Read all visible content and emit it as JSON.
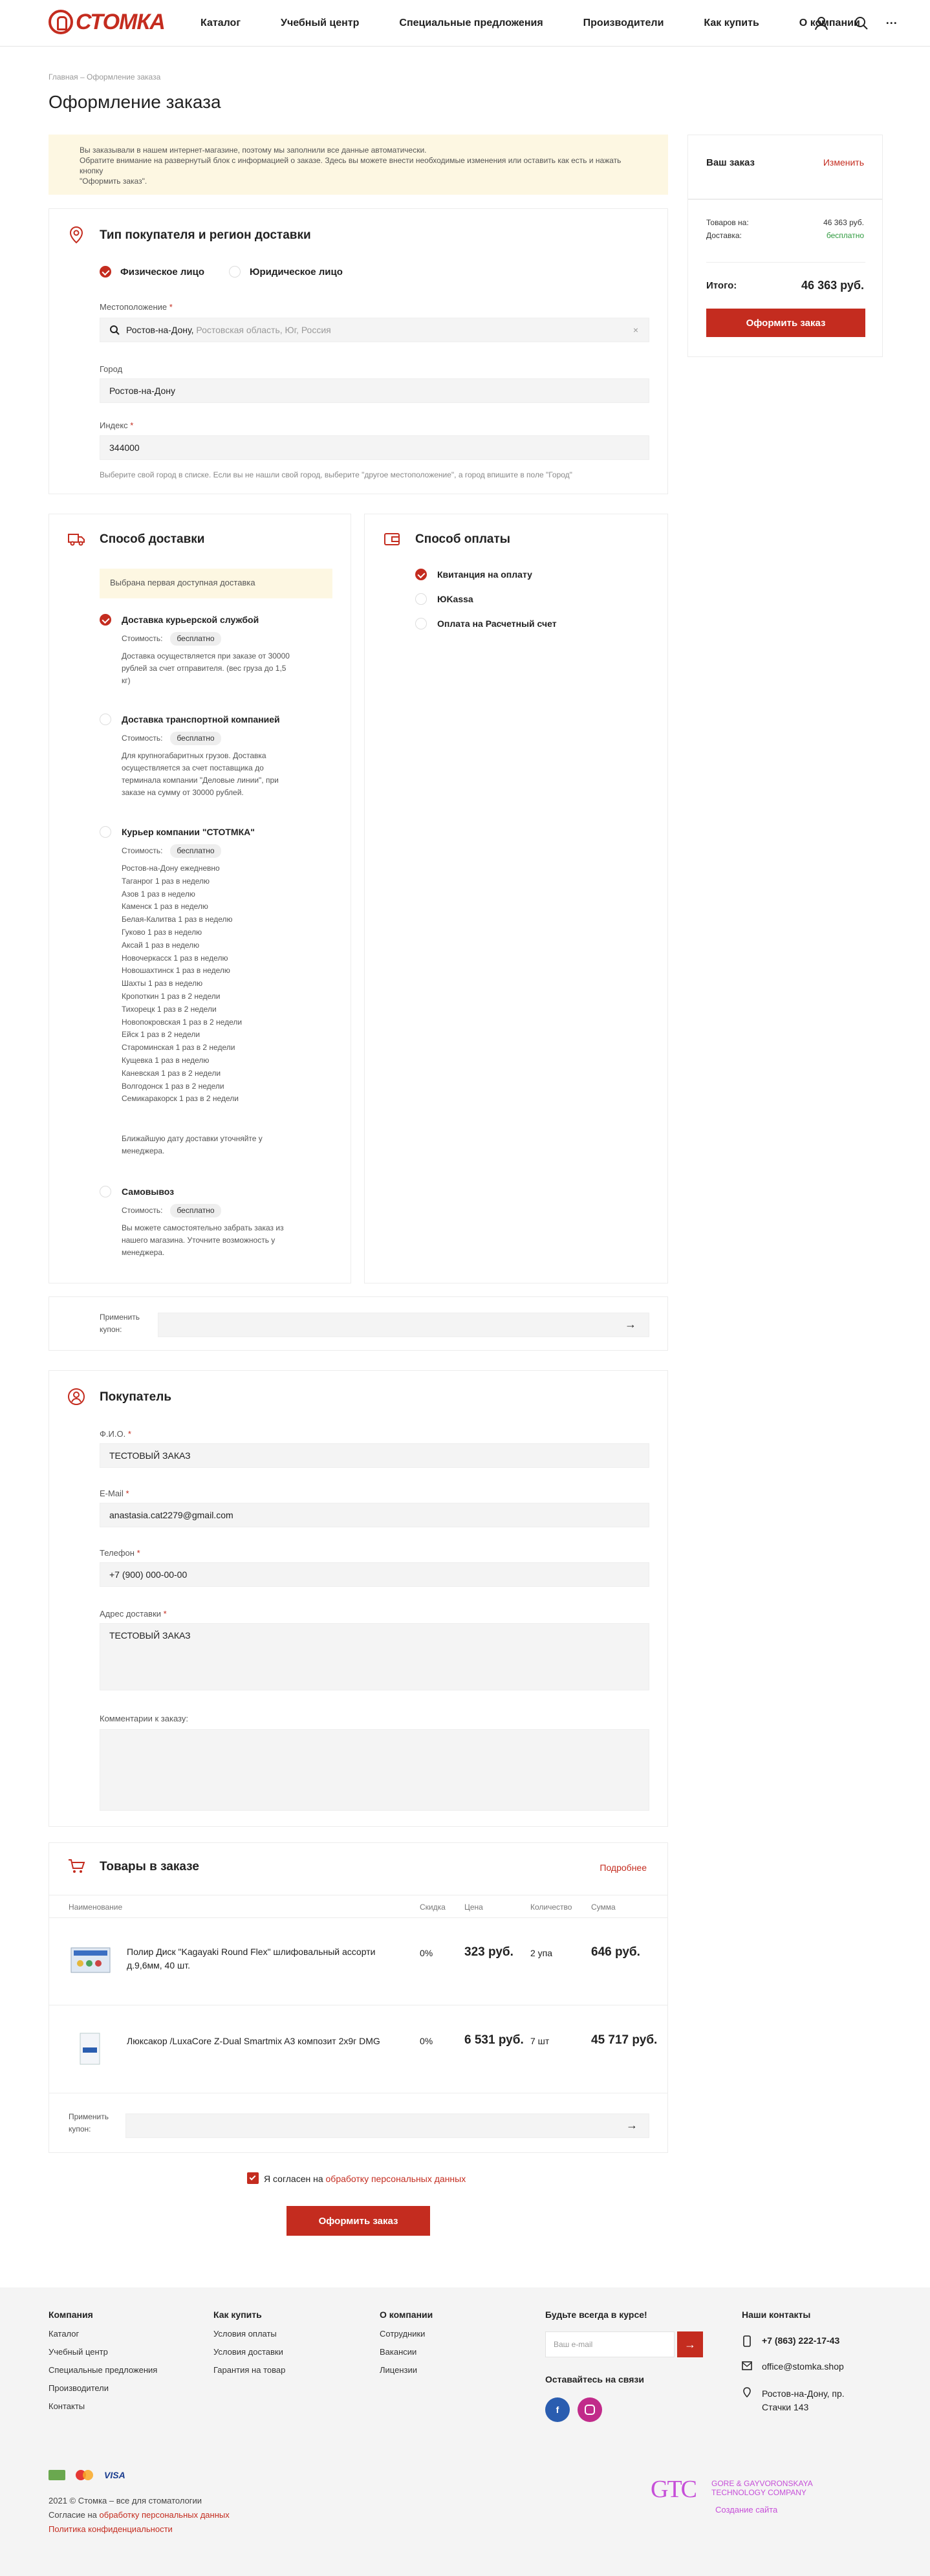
{
  "header": {
    "logo": "СТОМКА",
    "nav": [
      "Каталог",
      "Учебный центр",
      "Специальные предложения",
      "Производители",
      "Как купить",
      "О компании"
    ],
    "more": "···"
  },
  "breadcrumb": "Главная  –  Оформление заказа",
  "page_title": "Оформление заказа",
  "notice": {
    "line1": "Вы заказывали в нашем интернет-магазине, поэтому мы заполнили все данные автоматически.",
    "line2": "Обратите внимание на развернутый блок с информацией о заказе. Здесь вы можете внести необходимые изменения или оставить как есть и нажать кнопку",
    "line3": "\"Оформить заказ\"."
  },
  "buyer_type": {
    "title": "Тип покупателя и регион доставки",
    "option1": "Физическое лицо",
    "option2": "Юридическое лицо",
    "location_label": "Местоположение",
    "location_value": "Ростов-на-Дону,",
    "location_hint": "Ростовская область, Юг, Россия",
    "city_label": "Город",
    "city_value": "Ростов-на-Дону",
    "index_label": "Индекс",
    "index_value": "344000",
    "help": "Выберите свой город в списке. Если вы не нашли свой город, выберите \"другое местоположение\", а город впишите в поле \"Город\""
  },
  "summary": {
    "title": "Ваш заказ",
    "edit": "Изменить",
    "goods_label": "Товаров на:",
    "goods_value": "46 363 руб.",
    "delivery_label": "Доставка:",
    "delivery_value": "бесплатно",
    "total_label": "Итого:",
    "total_value": "46 363 руб.",
    "button": "Оформить заказ"
  },
  "delivery": {
    "title": "Способ доставки",
    "first_note": "Выбрана первая доступная доставка",
    "cost_label": "Стоимость:",
    "free": "бесплатно",
    "opt1_title": "Доставка курьерской службой",
    "opt1_desc": "Доставка осуществляется при заказе от 30000 рублей за счет отправителя. (вес груза до 1,5 кг)",
    "opt2_title": "Доставка транспортной компанией",
    "opt2_desc": "Для крупногабаритных грузов. Доставка осуществляется за счет поставщика до терминала компании \"Деловые линии\", при заказе на сумму от 30000 рублей.",
    "opt3_title": "Курьер компании \"СТОТМКА\"",
    "opt3_schedule": [
      "Ростов-на-Дону ежедневно",
      "Таганрог 1 раз в неделю",
      "Азов 1 раз в неделю",
      "Каменск 1 раз в неделю",
      "Белая-Калитва 1 раз в неделю",
      "Гуково 1 раз в неделю",
      "Аксай 1 раз в неделю",
      "Новочеркасск 1 раз в неделю",
      "Новошахтинск 1 раз в неделю",
      "Шахты 1 раз в неделю",
      "Кропоткин 1 раз в 2 недели",
      "Тихорецк 1 раз в 2 недели",
      "Новопокровская 1 раз в 2 недели",
      "Ейск 1 раз в 2 недели",
      "Староминская 1 раз в 2 недели",
      "Кущевка 1 раз в неделю",
      "Каневская 1 раз в 2 недели",
      "Волгодонск 1 раз в 2 недели",
      "Семикаракорск 1 раз в 2 недели"
    ],
    "opt3_note": "Ближайшую дату доставки уточняйте у менеджера.",
    "opt4_title": "Самовывоз",
    "opt4_desc": "Вы можете самостоятельно забрать заказ из нашего магазина. Уточните возможность у менеджера."
  },
  "payment": {
    "title": "Способ оплаты",
    "options": [
      "Квитанция на оплату",
      "ЮKassa",
      "Оплата на Расчетный счет"
    ]
  },
  "coupon": {
    "label": "Применить купон:",
    "arrow": "→"
  },
  "customer": {
    "title": "Покупатель",
    "fio_label": "Ф.И.О.",
    "fio_value": "ТЕСТОВЫЙ ЗАКАЗ",
    "email_label": "E-Mail",
    "email_value": "anastasia.cat2279@gmail.com",
    "phone_label": "Телефон",
    "phone_value": "+7 (900) 000-00-00",
    "address_label": "Адрес доставки",
    "address_value": "ТЕСТОВЫЙ ЗАКАЗ",
    "comment_label": "Комментарии к заказу:"
  },
  "goods": {
    "title": "Товары в заказе",
    "more": "Подробнее",
    "columns": [
      "Наименование",
      "Скидка",
      "Цена",
      "Количество",
      "Сумма"
    ],
    "rows": [
      {
        "name": "Полир Диск \"Kagayaki Round Flex\" шлифовальный ассорти д.9,6мм, 40 шт.",
        "discount": "0%",
        "price": "323 руб.",
        "qty": "2 упа",
        "sum": "646 руб."
      },
      {
        "name": "Люксакор /LuxaCore Z-Dual Smartmix A3 композит 2х9г DMG",
        "discount": "0%",
        "price": "6 531 руб.",
        "qty": "7 шт",
        "sum": "45 717 руб."
      }
    ]
  },
  "agree": {
    "prefix": "Я согласен на ",
    "link": "обработку персональных данных"
  },
  "submit": "Оформить заказ",
  "footer": {
    "col1_title": "Компания",
    "col1": [
      "Каталог",
      "Учебный центр",
      "Специальные предложения",
      "Производители",
      "Контакты"
    ],
    "col2_title": "Как купить",
    "col2": [
      "Условия оплаты",
      "Условия доставки",
      "Гарантия на товар"
    ],
    "col3_title": "О компании",
    "col3": [
      "Сотрудники",
      "Вакансии",
      "Лицензии"
    ],
    "subscribe_title": "Будьте всегда в курсе!",
    "subscribe_placeholder": "Ваш e-mail",
    "social_title": "Оставайтесь на связи",
    "contacts_title": "Наши контакты",
    "phone": "+7 (863) 222-17-43",
    "email": "office@stomka.shop",
    "address1": "Ростов-на-Дону, пр.",
    "address2": "Стачки 143",
    "copyright": "2021 © Стомка – все для стоматологии",
    "consent_prefix": "Согласие на ",
    "consent_link": "обработку персональных данных",
    "policy": "Политика конфиденциальности",
    "dev1": "GORE & GAYVORONSKAYA",
    "dev2": "TECHNOLOGY COMPANY",
    "dev_link": "Создание сайта",
    "dev_logo": "GTC",
    "visa": "VISA"
  },
  "colors": {
    "accent": "#c42c1f",
    "green": "#2e9a3e"
  }
}
